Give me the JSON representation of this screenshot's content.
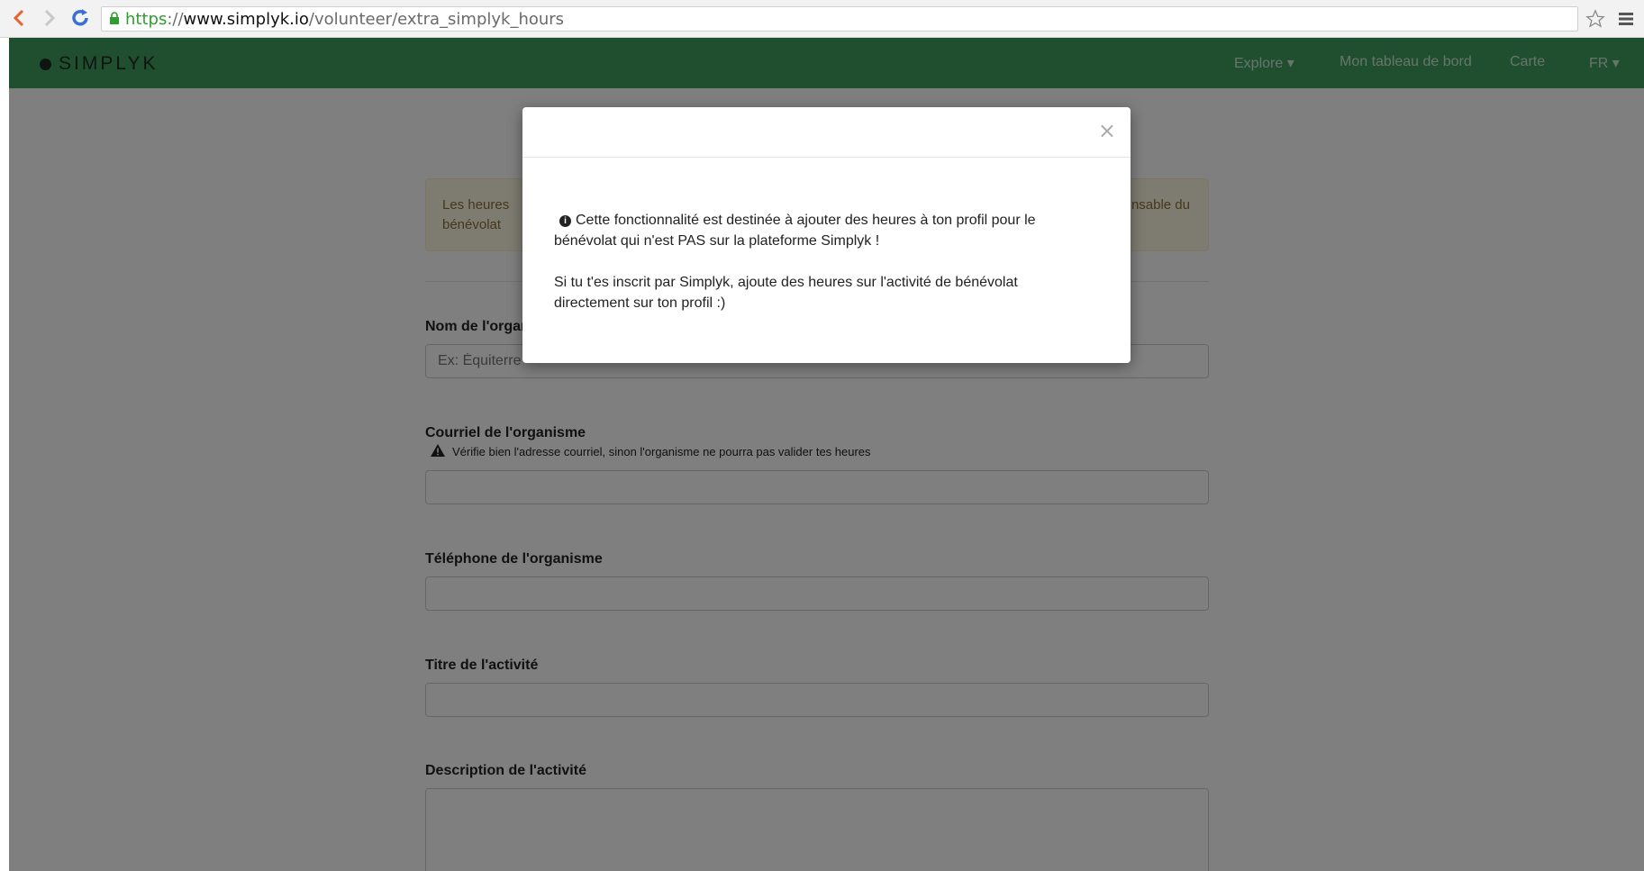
{
  "browser": {
    "url_scheme": "https",
    "url_separator": "://",
    "url_host": "www.simplyk.io",
    "url_path": "/volunteer/extra_simplyk_hours"
  },
  "navbar": {
    "brand": "SIMPLYK",
    "links": [
      "Explore ▾",
      "Mon tableau de bord",
      "Carte",
      "FR ▾"
    ]
  },
  "alert": {
    "left_text": "Les heures",
    "left_text_2": "bénévolat",
    "right_text": "nsable du"
  },
  "form": {
    "org_name_label": "Nom de l'organisme",
    "org_name_placeholder": "Ex: Équiterre",
    "org_email_label": "Courriel de l'organisme",
    "org_email_warning": "Vérifie bien l'adresse courriel, sinon l'organisme ne pourra pas valider tes heures",
    "org_phone_label": "Téléphone de l'organisme",
    "activity_title_label": "Titre de l'activité",
    "activity_desc_label": "Description de l'activité"
  },
  "modal": {
    "close": "×",
    "line1": "Cette fonctionnalité est destinée à ajouter des heures à ton profil pour le bénévolat qui n'est PAS sur la plateforme Simplyk !",
    "line2": "Si tu t'es inscrit par Simplyk, ajoute des heures sur l'activité de bénévolat directement sur ton profil :)"
  },
  "colors": {
    "navbar": "#3f9e5f",
    "alert_bg": "#fcf8e3"
  }
}
